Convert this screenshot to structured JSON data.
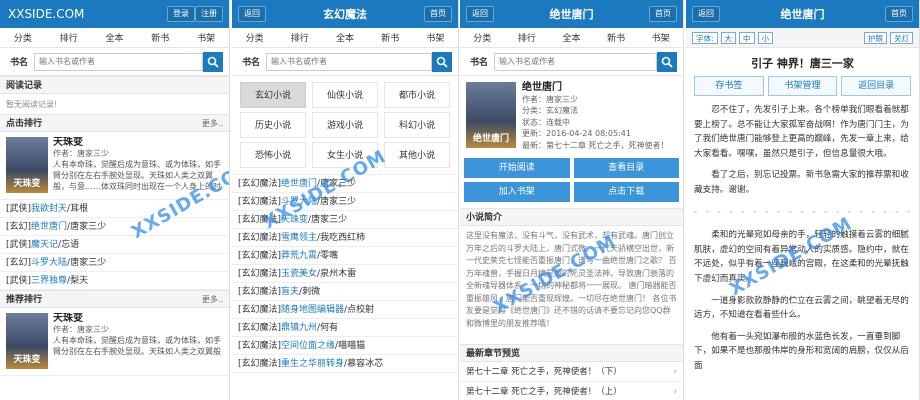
{
  "watermark": "XXSIDE.COM",
  "nav_items": [
    "分类",
    "排行",
    "全本",
    "新书",
    "书架"
  ],
  "search": {
    "label": "书名",
    "placeholder": "输入书名或作者"
  },
  "s1": {
    "brand": "XXSIDE.COM",
    "login": "登录",
    "register": "注册",
    "history_title": "阅读记录",
    "history_empty": "暂无阅读记录!",
    "click_rank": "点击排行",
    "more": "更多..",
    "featured": {
      "cover_text": "天珠变",
      "name": "天珠变",
      "author_label": "作者：",
      "author": "唐家三少",
      "desc": "人有本命珠，觉醒后成为意珠、或为体珠，如手臂分别在左右手腕处显现。天珠如人类之双翼般，与意……体双珠同时出现在一个人身上的时候，即为天"
    },
    "rank_rows": [
      {
        "cat": "[武侠]",
        "book": "我欲封天",
        "author": "/耳根"
      },
      {
        "cat": "[玄幻]",
        "book": "绝世唐门",
        "author": "/唐家三少"
      },
      {
        "cat": "[武侠]",
        "book": "魔天记",
        "author": "/忘语"
      },
      {
        "cat": "[玄幻]",
        "book": "斗罗大陆",
        "author": "/唐家三少"
      },
      {
        "cat": "[武侠]",
        "book": "三界独尊",
        "author": "/梨天"
      }
    ],
    "rec_rank": "推荐排行",
    "featured2": {
      "cover_text": "天珠变",
      "name": "天珠变",
      "author_label": "作者：",
      "author": "唐家三少",
      "desc": "人有本命珠，觉醒后成为意珠，或为体珠，如手臂分别在左右手腕处显现。天珠如人类之双翼般"
    }
  },
  "s2": {
    "back": "返回",
    "home": "首页",
    "title": "玄幻魔法",
    "categories": [
      "玄幻小说",
      "仙侠小说",
      "都市小说",
      "历史小说",
      "游戏小说",
      "科幻小说",
      "恐怖小说",
      "女生小说",
      "其他小说"
    ],
    "rows": [
      {
        "cat": "[玄幻魔法]",
        "book": "绝世唐门",
        "author": "/唐家三少"
      },
      {
        "cat": "[玄幻魔法]",
        "book": "斗罗大陆",
        "author": "/唐家三少"
      },
      {
        "cat": "[玄幻魔法]",
        "book": "天珠变",
        "author": "/唐家三少"
      },
      {
        "cat": "[玄幻魔法]",
        "book": "雪鹰领主",
        "author": "/我吃西红柿"
      },
      {
        "cat": "[玄幻魔法]",
        "book": "莽荒九霄",
        "author": "/零嘴"
      },
      {
        "cat": "[玄幻魔法]",
        "book": "玉瓷美女",
        "author": "/泉州木雷"
      },
      {
        "cat": "[玄幻魔法]",
        "book": "盲夫",
        "author": "/刺微"
      },
      {
        "cat": "[玄幻魔法]",
        "book": "随身地图编辑器",
        "author": "/点校射"
      },
      {
        "cat": "[玄幻魔法]",
        "book": "鼎镇九州",
        "author": "/何有"
      },
      {
        "cat": "[玄幻魔法]",
        "book": "空间位面之缘",
        "author": "/喵喵猫"
      },
      {
        "cat": "[玄幻魔法]",
        "book": "重生之华丽转身",
        "author": "/慕容冰芯"
      }
    ]
  },
  "s3": {
    "back": "返回",
    "home": "首页",
    "title": "绝世唐门",
    "cover_text": "绝世唐门",
    "book_title": "绝世唐门",
    "author_line": "作者：唐家三少",
    "category_line": "分类：玄幻魔法",
    "status_line": "状态：连载中",
    "updated_line": "更新：2016-04-24 08:05:41",
    "latest_line": "最新：第七十二章 死亡之手，死神使者！",
    "btn_start": "开始阅读",
    "btn_toc": "查看目录",
    "btn_shelf": "加入书架",
    "btn_download": "点击下载",
    "intro_title": "小说简介",
    "intro": "这里没有魔法，没有斗气，没有武术，却有武魂。唐门创立万年之后的斗罗大陆上，唐门式微。一代天骄横空出世，新一代史莱克七怪能否重振唐门，谱写一曲绝世唐门之歌？ 百万年魂兽，手握日月摘星辰的死灵圣法神，导致唐门衰落的全新魂导器体系。一切的神秘都将一一展现。 唐门暗器能否重振雄风，唐门能否重现辉煌。一切尽在绝世唐门！ 各位书友要是觉得《绝世唐门》还不错的话请不要忘记向您QQ群和微博里的朋友推荐哦！",
    "latest_title": "最新章节预览",
    "chapters": [
      "第七十二章 死亡之手，死神使者！（下）",
      "第七十二章 死亡之手，死神使者！（上）"
    ]
  },
  "s4": {
    "back": "返回",
    "home": "首页",
    "title": "绝世唐门",
    "font_label": "字体:",
    "font_sizes": [
      "大",
      "中",
      "小"
    ],
    "eye_care": "护眼",
    "lights_off": "关灯",
    "chapter_title": "引子 神界！唐三一家",
    "btn_bookmark": "存书签",
    "btn_shelf": "书架管理",
    "btn_toc": "返回目录",
    "p1": "忍不住了，先发引子上来。各个榜单我们眼看着就都要上榜了。总不能让大家孤军奋战啊！作为唐门门主，为了我们绝世唐门能够登上更高的巅峰，先发一章上来，给大家看看。嘿嘿，虽然只是引子，但信息量很大哦。",
    "p2": "看了之后，别忘记投票。新书急需大家的推荐票和收藏支持。谢谢。",
    "dashes": "- - - - - - - - - - - - - - - - - - - - - - - - - - - - - -",
    "p3": "柔和的光晕宛如母亲的手，轻轻的触摸着云雾的细腻肌肤，虚幻的空间有着异常动人的实质感。隐约中，就在不远处，似乎有着一座巍峨的宫殿，在这柔和的光晕抚触下虚幻而真实。",
    "p4": "一道身影款款静静的伫立在云雾之间，眺望着无尽的远方，不知道在看着些什么。",
    "p5": "他有着一头宛如瀑布般的水蓝色长发，一直垂到脚下，如果不是也那般伟岸的身形和宽阔的肩膀，仅仅从后面"
  }
}
